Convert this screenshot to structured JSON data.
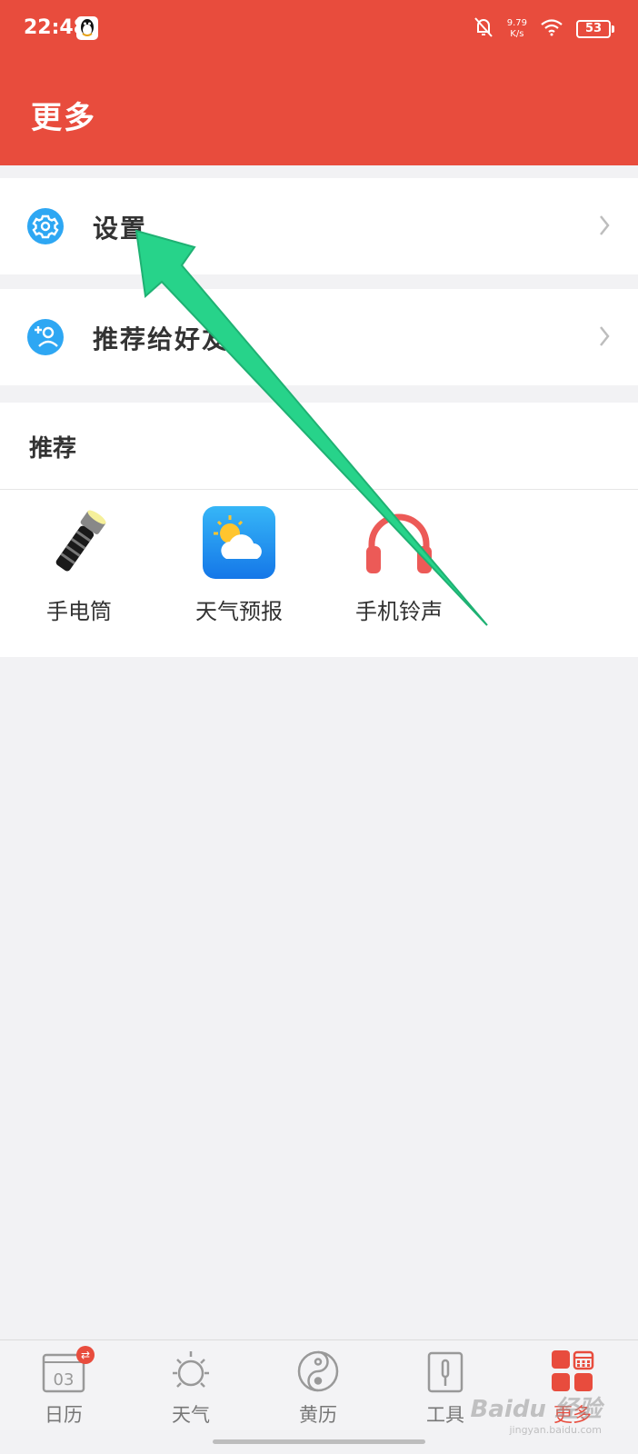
{
  "status_bar": {
    "time": "22:48",
    "net_speed": "9.79",
    "net_unit": "K/s",
    "battery": "53"
  },
  "header": {
    "title": "更多"
  },
  "menu": [
    {
      "label": "设置",
      "icon": "gear-icon"
    },
    {
      "label": "推荐给好友",
      "icon": "add-friend-icon"
    }
  ],
  "recommend": {
    "title": "推荐",
    "items": [
      {
        "label": "手电筒",
        "icon": "flashlight-icon"
      },
      {
        "label": "天气预报",
        "icon": "weather-icon"
      },
      {
        "label": "手机铃声",
        "icon": "headphones-icon"
      }
    ]
  },
  "tabs": [
    {
      "label": "日历",
      "icon": "calendar-icon",
      "date": "03",
      "active": false
    },
    {
      "label": "天气",
      "icon": "sun-icon",
      "active": false
    },
    {
      "label": "黄历",
      "icon": "yin-yang-icon",
      "active": false
    },
    {
      "label": "工具",
      "icon": "toolbox-icon",
      "active": false
    },
    {
      "label": "更多",
      "icon": "more-grid-icon",
      "active": true
    }
  ],
  "watermark": {
    "brand": "Baidu 经验",
    "url": "jingyan.baidu.com"
  },
  "colors": {
    "brand": "#e84c3d",
    "accent_blue": "#2ea7f3",
    "arrow": "#27d38a",
    "background": "#f2f2f4"
  }
}
